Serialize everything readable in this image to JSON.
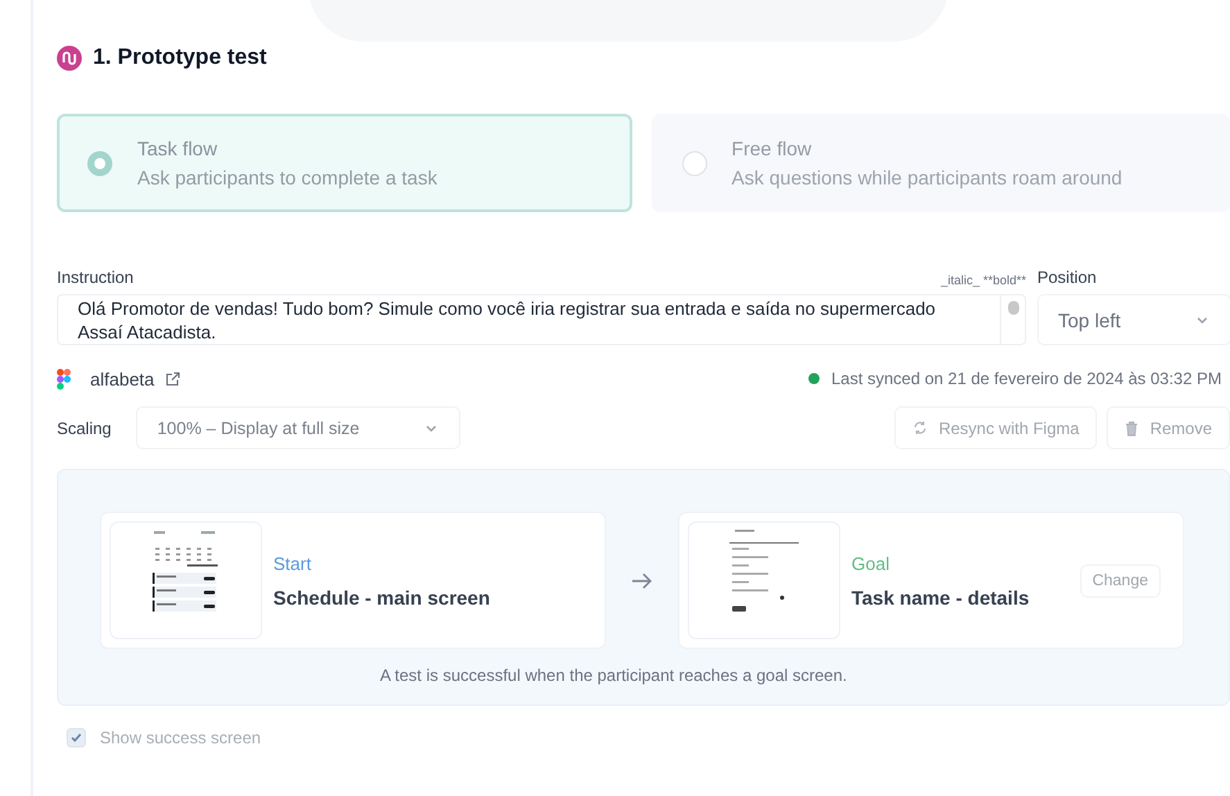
{
  "section": {
    "title": "1. Prototype test"
  },
  "flow_options": [
    {
      "title": "Task flow",
      "description": "Ask participants to complete a task",
      "selected": true
    },
    {
      "title": "Free flow",
      "description": "Ask questions while participants roam around",
      "selected": false
    }
  ],
  "instruction": {
    "label": "Instruction",
    "format_hint": "_italic_ **bold**",
    "value": "Olá Promotor de vendas! Tudo bom?  Simule como você iria registrar sua entrada e saída no supermercado Assaí Atacadista."
  },
  "position": {
    "label": "Position",
    "value": "Top left"
  },
  "figma_file": {
    "name": "alfabeta",
    "sync_status": "Last synced on 21 de fevereiro de 2024 às 03:32 PM"
  },
  "scaling": {
    "label": "Scaling",
    "value": "100% – Display at full size"
  },
  "actions": [
    "Resync with Figma",
    "Remove"
  ],
  "screens": [
    {
      "kind": "start",
      "role": "Start",
      "name": "Schedule - main screen"
    },
    {
      "kind": "goal",
      "role": "Goal",
      "name": "Task name - details",
      "action": "Change"
    }
  ],
  "flow_caption": "A test is successful when the participant reaches a goal screen.",
  "success_screen": {
    "label": "Show success screen",
    "checked": true
  }
}
